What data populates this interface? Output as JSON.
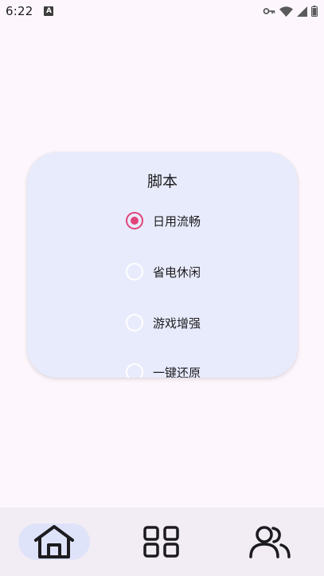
{
  "status_bar": {
    "time": "6:22",
    "notification_icon": "A",
    "icons": [
      "vpn-key-icon",
      "wifi-icon",
      "signal-icon",
      "battery-icon"
    ]
  },
  "dialog": {
    "title": "脚本",
    "options": [
      {
        "label": "日用流畅",
        "selected": true
      },
      {
        "label": "省电休闲",
        "selected": false
      },
      {
        "label": "游戏增强",
        "selected": false
      },
      {
        "label": "一键还原",
        "selected": false
      }
    ]
  },
  "bottom_nav": {
    "items": [
      {
        "icon": "home-icon",
        "active": true
      },
      {
        "icon": "grid-icon",
        "active": false
      },
      {
        "icon": "users-icon",
        "active": false
      }
    ]
  },
  "colors": {
    "background": "#fdf7fd",
    "card": "#e8ebfb",
    "accent": "#e0457a",
    "nav_background": "#f2edf4",
    "nav_active": "#dfe3f9"
  }
}
